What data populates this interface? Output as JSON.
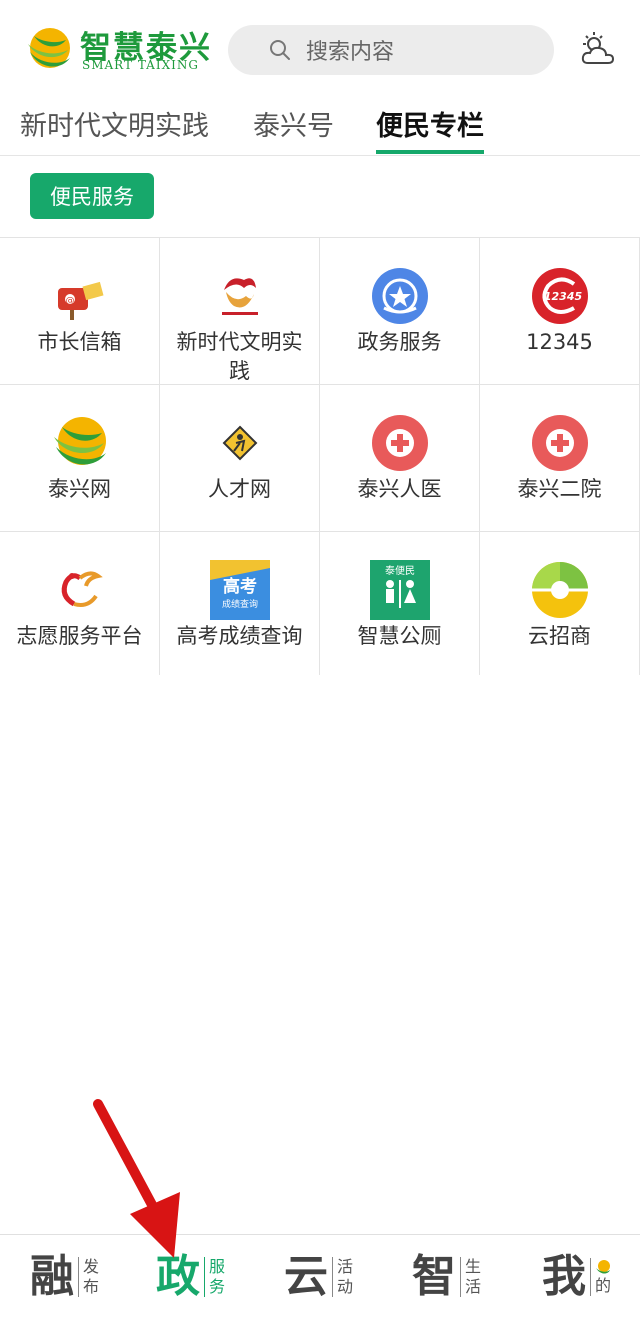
{
  "header": {
    "logo_cn": "智慧泰兴",
    "logo_en": "SMART TAIXING",
    "search_placeholder": "搜索内容",
    "weather_icon": "cloud-sun-icon"
  },
  "tabs": [
    {
      "label": "新时代文明实践",
      "active": false
    },
    {
      "label": "泰兴号",
      "active": false
    },
    {
      "label": "便民专栏",
      "active": true
    }
  ],
  "section": {
    "label": "便民服务"
  },
  "services": [
    {
      "label": "市长信箱",
      "icon": "mailbox-icon"
    },
    {
      "label": "新时代文明实践",
      "icon": "civilization-logo-icon"
    },
    {
      "label": "政务服务",
      "icon": "gov-service-icon"
    },
    {
      "label": "12345",
      "icon": "hotline-12345-icon"
    },
    {
      "label": "泰兴网",
      "icon": "taixing-logo-icon"
    },
    {
      "label": "人才网",
      "icon": "talent-icon"
    },
    {
      "label": "泰兴人医",
      "icon": "hospital-cross-icon"
    },
    {
      "label": "泰兴二院",
      "icon": "hospital-cross-icon"
    },
    {
      "label": "志愿服务平台",
      "icon": "volunteer-bird-icon"
    },
    {
      "label": "高考成绩查询",
      "icon": "gaokao-icon"
    },
    {
      "label": "智慧公厕",
      "icon": "toilet-icon"
    },
    {
      "label": "云招商",
      "icon": "cloud-invest-icon"
    }
  ],
  "bottom_nav": [
    {
      "big": "融",
      "small1": "发",
      "small2": "布",
      "active": false
    },
    {
      "big": "政",
      "small1": "服",
      "small2": "务",
      "active": true
    },
    {
      "big": "云",
      "small1": "活",
      "small2": "动",
      "active": false
    },
    {
      "big": "智",
      "small1": "生",
      "small2": "活",
      "active": false
    },
    {
      "big": "我",
      "small1": "",
      "small2": "的",
      "active": false
    }
  ],
  "colors": {
    "accent": "#17a86b",
    "brand": "#1e9a3c",
    "arrow": "#d81414"
  }
}
